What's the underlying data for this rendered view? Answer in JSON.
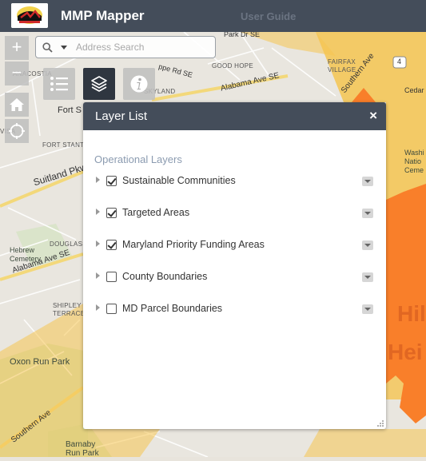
{
  "header": {
    "app_title": "MMP Mapper",
    "user_guide_label": "User Guide",
    "logo_icon": "maryland-state-seal-logo"
  },
  "map_controls": {
    "zoom_in_label": "+",
    "zoom_out_label": "−",
    "home_icon": "home-icon",
    "locate_icon": "locate-icon"
  },
  "search": {
    "placeholder": "Address Search",
    "value": ""
  },
  "widgets": [
    {
      "name": "legend",
      "icon": "list-icon"
    },
    {
      "name": "layer-list",
      "icon": "layers-icon",
      "active": true
    },
    {
      "name": "about",
      "icon": "info-icon"
    }
  ],
  "map_labels": {
    "anacostia": "ANACOSTIA",
    "fort_stanton": "FORT STANTO",
    "fort_s": "Fort S",
    "douglass": "DOUGLASS",
    "hebrew_cemetery": "Hebrew\nCemetery",
    "shipley_terrace": "SHIPLEY\nTERRACE",
    "oxon_run_park": "Oxon Run Park",
    "barnaby_run_park": "Barnaby\nRun Park",
    "good_hope": "GOOD HOPE",
    "fairfax_village": "FAIRFAX\nVILLAGE",
    "park_dr": "Park Dr SE",
    "alabama_ave_1": "Alabama Ave SE",
    "alabama_ave_2": "Alabama Ave SE",
    "suitland_pkwy": "Suitland Pkwy",
    "southern_ave": "Southern Ave",
    "southern_ave_2": "Southern Ave",
    "skyland": "SKYLAND",
    "pope_rd": "ppe Rd SE",
    "visa": "VISA",
    "cedar": "Cedar",
    "washington_national": "Washi\nNatio\nCeme",
    "route_4": "4",
    "hil": "Hil",
    "hei": "Hei"
  },
  "layer_list": {
    "title": "Layer List",
    "close_label": "×",
    "section_title": "Operational Layers",
    "layers": [
      {
        "label": "Sustainable Communities",
        "checked": true
      },
      {
        "label": "Targeted Areas",
        "checked": true
      },
      {
        "label": "Maryland Priority Funding Areas",
        "checked": true
      },
      {
        "label": "County Boundaries",
        "checked": false
      },
      {
        "label": "MD Parcel Boundaries",
        "checked": false
      }
    ]
  },
  "colors": {
    "header_bg": "#444d5a",
    "active_widget": "#2f3640",
    "pfa_yellow": "#f5c451",
    "sustainable_orange": "#f97f2a"
  }
}
